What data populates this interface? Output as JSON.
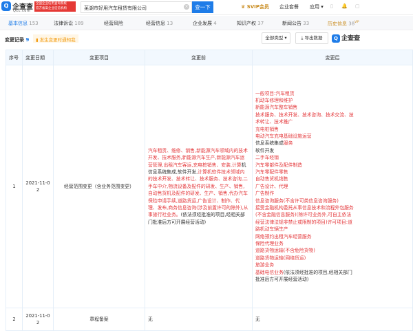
{
  "header": {
    "logo_text": "企查查",
    "logo_sub": "Qcc.com",
    "badge_line1": "全国企业信用查询系统",
    "badge_line2": "官方备案企业征信机构",
    "search_value": "芜湖市好用汽车租赁有限公司",
    "search_button": "查一下",
    "vip": "SVIP会员",
    "links": [
      "企业套餐",
      "应用 ▾"
    ]
  },
  "tabs": [
    {
      "label": "基本信息",
      "count": "153"
    },
    {
      "label": "法律诉讼",
      "count": "189"
    },
    {
      "label": "经营风险",
      "count": ""
    },
    {
      "label": "经营信息",
      "count": "13"
    },
    {
      "label": "企业发展",
      "count": "4"
    },
    {
      "label": "知识产权",
      "count": "37"
    },
    {
      "label": "新闻公告",
      "count": "33"
    },
    {
      "label": "历史信息",
      "count": "38",
      "tag": "VIP"
    }
  ],
  "toolbar": {
    "title": "变更记录",
    "count": "9",
    "notify": "发生变更时通知我",
    "filter": "全部类型 ▾",
    "export": "导出数据",
    "brand": "企查查"
  },
  "table": {
    "headers": [
      "序号",
      "变更日期",
      "变更项目",
      "变更前",
      "变更后"
    ],
    "rows": [
      {
        "index": "1",
        "date_l1": "2021-11-0",
        "date_l2": "2",
        "item": "经营范围变更（含业务范围变更）",
        "before": [
          {
            "t": "汽车租赁、维修、销售,新能源汽车领域内的技术开发、技术服务,新能源汽车生产,新能源汽车运营管理,出租汽车客运,充电桩销售、安装,计算",
            "hl": true
          },
          {
            "t": "机信息系统集成,软件开发,",
            "hl": false
          },
          {
            "t": "计算机软件技术领域内的技术开发、技术转让、技术服务、技术咨询,二手车中介,物流设备及配件的研发、生产、销售,自动售货机及配件的研发、生产、销售,代办汽车保险申请手续,道路货运,广告设计、制作、代理、发布,商务信息咨询(涉及前置许可的除外),从事旅行社业务。",
            "hl": true
          },
          {
            "t": "(依法须经批准的项目,经相关部门批准后方可开展经营活动)",
            "hl": false
          }
        ],
        "after": [
          [
            {
              "t": "一般项目:汽车租赁",
              "hl": true
            }
          ],
          [
            {
              "t": "机动车修理和维护",
              "hl": true
            }
          ],
          [
            {
              "t": "新能源汽车整车销售",
              "hl": true
            }
          ],
          [
            {
              "t": "技术服务、技术开发、技术咨询、技术交流、技",
              "hl": true
            }
          ],
          [
            {
              "t": "术转让、技术推广",
              "hl": true
            }
          ],
          [
            {
              "t": "充电桩销售",
              "hl": true
            }
          ],
          [
            {
              "t": "电动汽车充电基础设施运营",
              "hl": true
            }
          ],
          [
            {
              "t": "信息系统集成",
              "hl": false
            },
            {
              "t": "服务",
              "hl": true
            }
          ],
          [
            {
              "t": "软件开发",
              "hl": false
            }
          ],
          [
            {
              "t": "二手车经销",
              "hl": true
            }
          ],
          [
            {
              "t": "汽车零部件及配件制造",
              "hl": true
            }
          ],
          [
            {
              "t": "汽车零配件零售",
              "hl": true
            }
          ],
          [
            {
              "t": "自动售货机销售",
              "hl": true
            }
          ],
          [
            {
              "t": "广告设计、代理",
              "hl": true
            }
          ],
          [
            {
              "t": "广告制作",
              "hl": true
            }
          ],
          [
            {
              "t": "信息咨询服务(不含许可类信息咨询服务)",
              "hl": true
            }
          ],
          [
            {
              "t": "接受金融机构委托从事信息技术和流程外包服务",
              "hl": true
            }
          ],
          [
            {
              "t": "(不含金融信息服务)(除许可业务外,可自主依法",
              "hl": true
            }
          ],
          [
            {
              "t": "经营法律法规非禁止或限制的项目)许可项目:道",
              "hl": true
            }
          ],
          [
            {
              "t": "路机动车辆生产",
              "hl": true
            }
          ],
          [
            {
              "t": "网络预约出租汽车经营服务",
              "hl": true
            }
          ],
          [
            {
              "t": "保险代理业务",
              "hl": true
            }
          ],
          [
            {
              "t": "道路货物运输(不含危险货物)",
              "hl": true
            }
          ],
          [
            {
              "t": "道路货物运输(网络货运)",
              "hl": true
            }
          ],
          [
            {
              "t": "旅游业务",
              "hl": true
            }
          ],
          [
            {
              "t": "基础电信业务",
              "hl": true
            },
            {
              "t": "(依法须经批准的项目,经相关部门",
              "hl": false
            }
          ],
          [
            {
              "t": "批准后方可开展经营活动)",
              "hl": false
            }
          ]
        ]
      },
      {
        "index": "2",
        "date_l1": "2021-11-0",
        "date_l2": "2",
        "item": "章程备案",
        "before_text": "无",
        "after_text": "无"
      }
    ]
  }
}
